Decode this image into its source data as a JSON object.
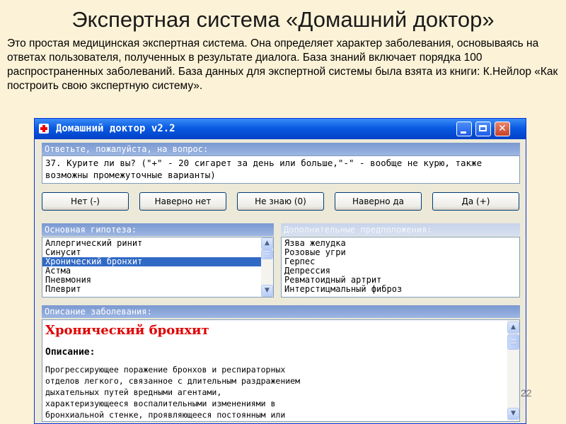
{
  "slide": {
    "title": "Экспертная система «Домашний доктор»",
    "intro": "Это простая медицинская экспертная система. Она определяет характер заболевания, основываясь на ответах пользователя, полученных в результате диалога. База знаний включает порядка 100 распространенных заболеваний. База данных для экспертной системы была взята из книги: К.Нейлор «Как построить свою экспертную систему».",
    "page_number": "22"
  },
  "window": {
    "title": "Домашний доктор v2.2",
    "close_glyph": "✕"
  },
  "question_panel": {
    "header": "Ответьте, пожалуйста, на вопрос:",
    "text": "37. Курите ли вы? (\"+\" - 20 сигарет за день или больше,\"-\" - вообще не курю, также возможны промежуточные варианты)"
  },
  "answers": [
    "Нет (-)",
    "Наверно нет",
    "Не знаю (0)",
    "Наверно да",
    "Да (+)"
  ],
  "main_hypothesis": {
    "header": "Основная гипотеза:",
    "items": [
      "Аллергический ринит",
      "Синусит",
      "Хронический бронхит",
      "Астма",
      "Пневмония",
      "Плеврит"
    ],
    "selected_index": 2
  },
  "additional": {
    "header": "Дополнительные предположения:",
    "items": [
      "Язва желудка",
      "Розовые угри",
      "Герпес",
      "Депрессия",
      "Ревматоидный артрит",
      "Интерстицмальный фиброз"
    ]
  },
  "description_panel": {
    "header": "Описание заболевания:",
    "disease_title": "Хронический бронхит",
    "label": "Описание:",
    "lines": [
      "Прогрессирующее поражение  бронхов и респираторных",
      "отделов легкого,  связанное с длительным раздражением",
      "дыхательных путей  вредными  агентами,",
      "характеризующееся воспалительными изменениями в",
      "бронхиальной стенке,  проявляющееся постоянным  или"
    ]
  },
  "scroll_glyphs": {
    "up": "▲",
    "down": "▼"
  },
  "colors": {
    "slide_bg": "#fbf2d7",
    "titlebar": "#0a5be2",
    "selection": "#316ac5",
    "disease_title": "#e00000"
  }
}
